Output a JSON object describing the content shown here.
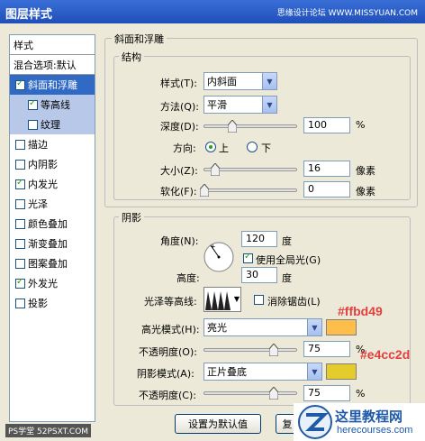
{
  "window": {
    "title": "图层样式",
    "watermark": "思缘设计论坛 WWW.MISSYUAN.COM"
  },
  "sidebar": {
    "header": "样式",
    "items": [
      {
        "label": "混合选项:默认",
        "type": "head"
      },
      {
        "label": "斜面和浮雕",
        "checked": true,
        "selected": true
      },
      {
        "label": "等高线",
        "checked": true,
        "sub": true
      },
      {
        "label": "纹理",
        "checked": false,
        "sub": true
      },
      {
        "label": "描边",
        "checked": false
      },
      {
        "label": "内阴影",
        "checked": false
      },
      {
        "label": "内发光",
        "checked": true
      },
      {
        "label": "光泽",
        "checked": false
      },
      {
        "label": "颜色叠加",
        "checked": false
      },
      {
        "label": "渐变叠加",
        "checked": false
      },
      {
        "label": "图案叠加",
        "checked": false
      },
      {
        "label": "外发光",
        "checked": true
      },
      {
        "label": "投影",
        "checked": false
      }
    ]
  },
  "bevel": {
    "section_title": "斜面和浮雕",
    "structure": {
      "title": "结构",
      "style_label": "样式(T):",
      "style_value": "内斜面",
      "method_label": "方法(Q):",
      "method_value": "平滑",
      "depth_label": "深度(D):",
      "depth_value": "100",
      "depth_unit": "%",
      "depth_level": 0.3,
      "direction_label": "方向:",
      "dir_up": "上",
      "dir_down": "下",
      "size_label": "大小(Z):",
      "size_value": "16",
      "size_unit": "像素",
      "size_level": 0.12,
      "soften_label": "软化(F):",
      "soften_value": "0",
      "soften_unit": "像素",
      "soften_level": 0.0
    },
    "shading": {
      "title": "阴影",
      "angle_label": "角度(N):",
      "angle_value": "120",
      "angle_unit": "度",
      "global_light_label": "使用全局光(G)",
      "altitude_label": "高度:",
      "altitude_value": "30",
      "altitude_unit": "度",
      "gloss_label": "光泽等高线:",
      "antialias_label": "消除锯齿(L)",
      "highlight_mode_label": "高光模式(H):",
      "highlight_mode_value": "亮光",
      "highlight_color": "#ffbd49",
      "highlight_annot": "#ffbd49",
      "highlight_opacity_label": "不透明度(O):",
      "highlight_opacity_value": "75",
      "highlight_opacity_level": 0.75,
      "shadow_mode_label": "阴影模式(A):",
      "shadow_mode_value": "正片叠底",
      "shadow_color": "#e4cc2d",
      "shadow_annot": "#e4cc2d",
      "shadow_opacity_label": "不透明度(C):",
      "shadow_opacity_value": "75",
      "shadow_opacity_level": 0.75,
      "opacity_unit": "%"
    }
  },
  "buttons": {
    "default_label": "设置为默认值",
    "reset_label": "复"
  },
  "footer": {
    "ps_credit": "PS学堂",
    "ps_url": "52PSXT.COM",
    "logo_text": "这里教程网",
    "logo_url": "herecourses.com"
  }
}
